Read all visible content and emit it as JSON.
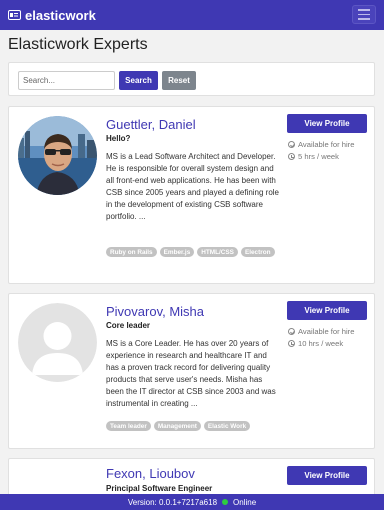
{
  "app": {
    "brand": "elasticwork"
  },
  "page": {
    "title": "Elasticwork Experts"
  },
  "search": {
    "placeholder": "Search...",
    "search_label": "Search",
    "reset_label": "Reset"
  },
  "experts": [
    {
      "name": "Guettler, Daniel",
      "subtitle": "Hello?",
      "bio": "MS is a Lead Software Architect and Developer. He is responsible for overall system design and all front-end web applications. He has been with CSB since 2005 years and played a defining role in the development of existing CSB software portfolio. ...",
      "availability": "Available for hire",
      "hours": "5 hrs / week",
      "tags": [
        "Ruby on Rails",
        "Ember.js",
        "HTML/CSS",
        "Electron"
      ],
      "button": "View Profile"
    },
    {
      "name": "Pivovarov, Misha",
      "subtitle": "Core leader",
      "bio": "MS is a Core Leader. He has over 20 years of experience in research and healthcare IT and has a proven track record for delivering quality products that serve user's needs. Misha has been the IT director at CSB since 2003 and was instrumental in creating ...",
      "availability": "Available for hire",
      "hours": "10 hrs / week",
      "tags": [
        "Team leader",
        "Management",
        "Elastic Work"
      ],
      "button": "View Profile"
    },
    {
      "name": "Fexon, Lioubov",
      "subtitle": "Principal Software Engineer",
      "button": "View Profile"
    }
  ],
  "footer": {
    "version": "Version: 0.0.1+7217a618",
    "status": "Online",
    "status_color": "#2ecc40"
  },
  "colors": {
    "primary": "#3f38b3",
    "secondary": "#7d858d",
    "background": "#f2f2f2"
  }
}
